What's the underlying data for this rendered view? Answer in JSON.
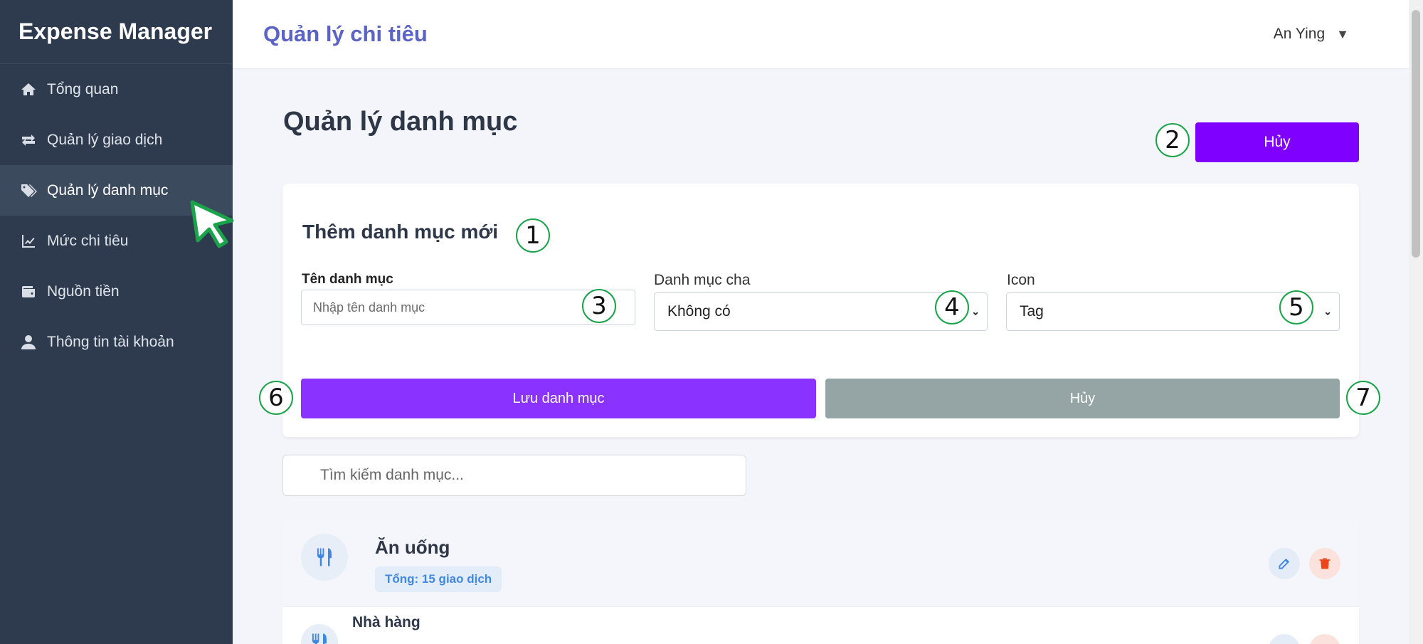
{
  "app": {
    "brand": "Expense Manager"
  },
  "sidebar": {
    "items": [
      {
        "label": "Tổng quan",
        "icon": "home-icon"
      },
      {
        "label": "Quản lý giao dịch",
        "icon": "exchange-icon"
      },
      {
        "label": "Quản lý danh mục",
        "icon": "tags-icon",
        "active": true
      },
      {
        "label": "Mức chi tiêu",
        "icon": "chart-line-icon"
      },
      {
        "label": "Nguồn tiền",
        "icon": "wallet-icon"
      },
      {
        "label": "Thông tin tài khoản",
        "icon": "user-icon"
      }
    ]
  },
  "header": {
    "title": "Quản lý chi tiêu",
    "user": "An Ying",
    "caret": "▼"
  },
  "page": {
    "title": "Quản lý danh mục",
    "top_cancel": "Hủy"
  },
  "form": {
    "title": "Thêm danh mục mới",
    "name_label": "Tên danh mục",
    "name_placeholder": "Nhập tên danh mục",
    "parent_label": "Danh mục cha",
    "parent_value": "Không có",
    "icon_label": "Icon",
    "icon_value": "Tag",
    "save_label": "Lưu danh mục",
    "cancel_label": "Hủy"
  },
  "search": {
    "placeholder": "Tìm kiếm danh mục..."
  },
  "categories": [
    {
      "name": "Ăn uống",
      "badge": "Tổng: 15 giao dịch",
      "icon": "utensils-icon"
    },
    {
      "name": "Nhà hàng",
      "icon": "utensils-icon"
    }
  ],
  "annotations": [
    "1",
    "2",
    "3",
    "4",
    "5",
    "6",
    "7"
  ],
  "colors": {
    "sidebar_bg": "#2e3b4e",
    "accent_purple": "#8000ff",
    "save_purple": "#8a32ff",
    "cancel_gray": "#95a5a6",
    "header_title": "#5b63c4",
    "annotation_green": "#1aa34a"
  }
}
